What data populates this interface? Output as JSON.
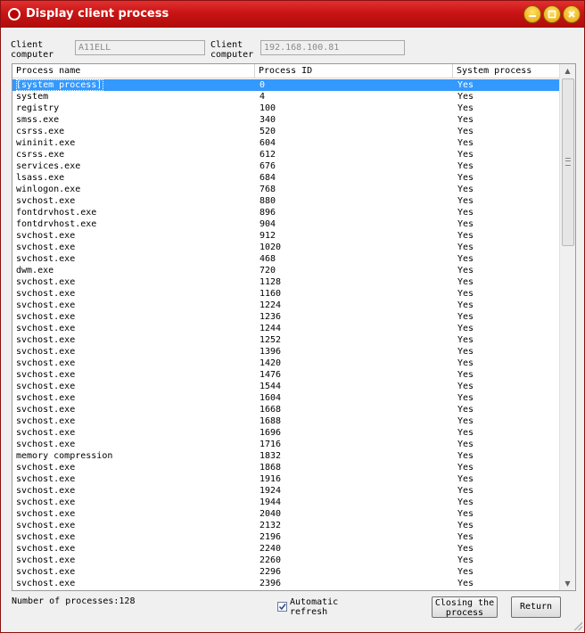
{
  "window": {
    "title": "Display client process",
    "accent_color": "#c81414",
    "selection_color": "#3399ff"
  },
  "client": {
    "computer_label": "Client computer",
    "computer_value": "A11ELL",
    "ip_label": "Client computer IP",
    "ip_value": "192.168.100.81"
  },
  "table": {
    "columns": [
      "Process name",
      "Process ID",
      "System process"
    ],
    "selected_index": 0,
    "rows": [
      [
        "[system process]",
        "0",
        "Yes"
      ],
      [
        "system",
        "4",
        "Yes"
      ],
      [
        "registry",
        "100",
        "Yes"
      ],
      [
        "smss.exe",
        "340",
        "Yes"
      ],
      [
        "csrss.exe",
        "520",
        "Yes"
      ],
      [
        "wininit.exe",
        "604",
        "Yes"
      ],
      [
        "csrss.exe",
        "612",
        "Yes"
      ],
      [
        "services.exe",
        "676",
        "Yes"
      ],
      [
        "lsass.exe",
        "684",
        "Yes"
      ],
      [
        "winlogon.exe",
        "768",
        "Yes"
      ],
      [
        "svchost.exe",
        "880",
        "Yes"
      ],
      [
        "fontdrvhost.exe",
        "896",
        "Yes"
      ],
      [
        "fontdrvhost.exe",
        "904",
        "Yes"
      ],
      [
        "svchost.exe",
        "912",
        "Yes"
      ],
      [
        "svchost.exe",
        "1020",
        "Yes"
      ],
      [
        "svchost.exe",
        "468",
        "Yes"
      ],
      [
        "dwm.exe",
        "720",
        "Yes"
      ],
      [
        "svchost.exe",
        "1128",
        "Yes"
      ],
      [
        "svchost.exe",
        "1160",
        "Yes"
      ],
      [
        "svchost.exe",
        "1224",
        "Yes"
      ],
      [
        "svchost.exe",
        "1236",
        "Yes"
      ],
      [
        "svchost.exe",
        "1244",
        "Yes"
      ],
      [
        "svchost.exe",
        "1252",
        "Yes"
      ],
      [
        "svchost.exe",
        "1396",
        "Yes"
      ],
      [
        "svchost.exe",
        "1420",
        "Yes"
      ],
      [
        "svchost.exe",
        "1476",
        "Yes"
      ],
      [
        "svchost.exe",
        "1544",
        "Yes"
      ],
      [
        "svchost.exe",
        "1604",
        "Yes"
      ],
      [
        "svchost.exe",
        "1668",
        "Yes"
      ],
      [
        "svchost.exe",
        "1688",
        "Yes"
      ],
      [
        "svchost.exe",
        "1696",
        "Yes"
      ],
      [
        "svchost.exe",
        "1716",
        "Yes"
      ],
      [
        "memory compression",
        "1832",
        "Yes"
      ],
      [
        "svchost.exe",
        "1868",
        "Yes"
      ],
      [
        "svchost.exe",
        "1916",
        "Yes"
      ],
      [
        "svchost.exe",
        "1924",
        "Yes"
      ],
      [
        "svchost.exe",
        "1944",
        "Yes"
      ],
      [
        "svchost.exe",
        "2040",
        "Yes"
      ],
      [
        "svchost.exe",
        "2132",
        "Yes"
      ],
      [
        "svchost.exe",
        "2196",
        "Yes"
      ],
      [
        "svchost.exe",
        "2240",
        "Yes"
      ],
      [
        "svchost.exe",
        "2260",
        "Yes"
      ],
      [
        "svchost.exe",
        "2296",
        "Yes"
      ],
      [
        "svchost.exe",
        "2396",
        "Yes"
      ]
    ]
  },
  "footer": {
    "process_count": "Number of processes:128",
    "auto_refresh_label": "Automatic refresh",
    "auto_refresh_checked": true,
    "close_process_label": "Closing the process",
    "return_label": "Return"
  }
}
